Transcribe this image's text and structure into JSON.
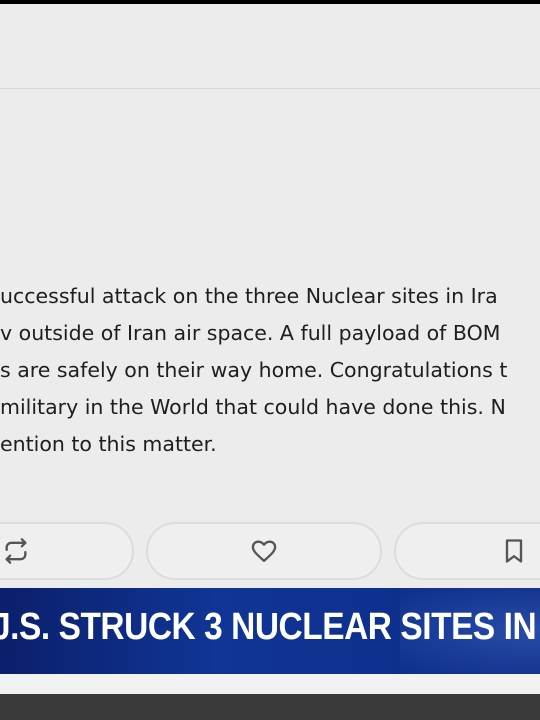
{
  "post": {
    "lines": [
      "uccessful attack on the three Nuclear sites in Ira",
      "v outside of Iran air space. A full payload of BOM",
      "s are safely on their way home. Congratulations t",
      "military in the World that could have done this. N",
      "ention to this matter."
    ]
  },
  "actions": {
    "repost_icon": "repost-icon",
    "like_icon": "heart-icon",
    "bookmark_icon": "bookmark-icon"
  },
  "banner": {
    "headline": "J.S. STRUCK 3 NUCLEAR SITES IN"
  },
  "colors": {
    "background": "#ececec",
    "text": "#1e1e1e",
    "banner": "#103596",
    "banner_text": "#ffffff",
    "icon": "#555555"
  }
}
